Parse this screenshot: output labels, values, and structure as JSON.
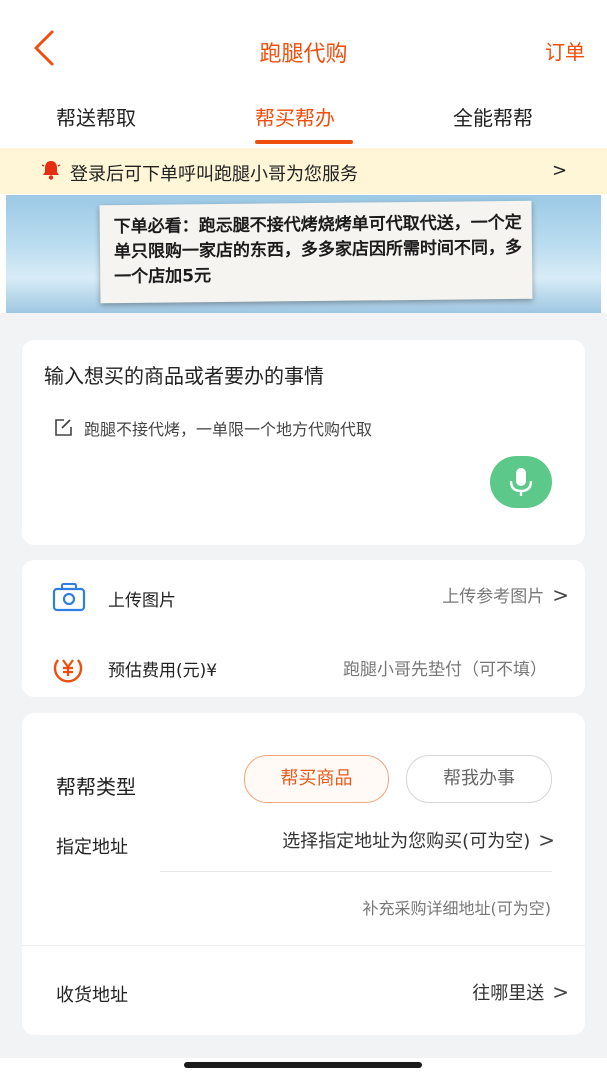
{
  "header": {
    "title": "跑腿代购",
    "orders_label": "订单"
  },
  "tabs": [
    {
      "label": "帮送帮取",
      "active": false
    },
    {
      "label": "帮买帮办",
      "active": true
    },
    {
      "label": "全能帮帮",
      "active": false
    }
  ],
  "login_banner": {
    "text": "登录后可下单呼叫跑腿小哥为您服务",
    "arrow": ">"
  },
  "notice": {
    "text": "下单必看：跑忈腿不接代烤烧烤单可代取代送，一个定单只限购一家店的东西，多多家店因所需时间不同，多一个店加5元"
  },
  "input_card": {
    "title": "输入想买的商品或者要办的事情",
    "placeholder": "跑腿不接代烤，一单限一个地方代购代取"
  },
  "upload": {
    "label": "上传图片",
    "hint": "上传参考图片"
  },
  "fee": {
    "label": "预估费用(元)¥",
    "placeholder": "跑腿小哥先垫付（可不填）"
  },
  "help_type": {
    "label": "帮帮类型",
    "options": [
      {
        "label": "帮买商品",
        "selected": true
      },
      {
        "label": "帮我办事",
        "selected": false
      }
    ]
  },
  "address": {
    "label": "指定地址",
    "select_text": "选择指定地址为您购买(可为空)",
    "detail_placeholder": "补充采购详细地址(可为空)"
  },
  "receive": {
    "label": "收货地址",
    "hint": "往哪里送"
  },
  "colors": {
    "accent": "#f04e0c",
    "mic": "#5cc98a",
    "banner_bg": "#fff6d8"
  }
}
